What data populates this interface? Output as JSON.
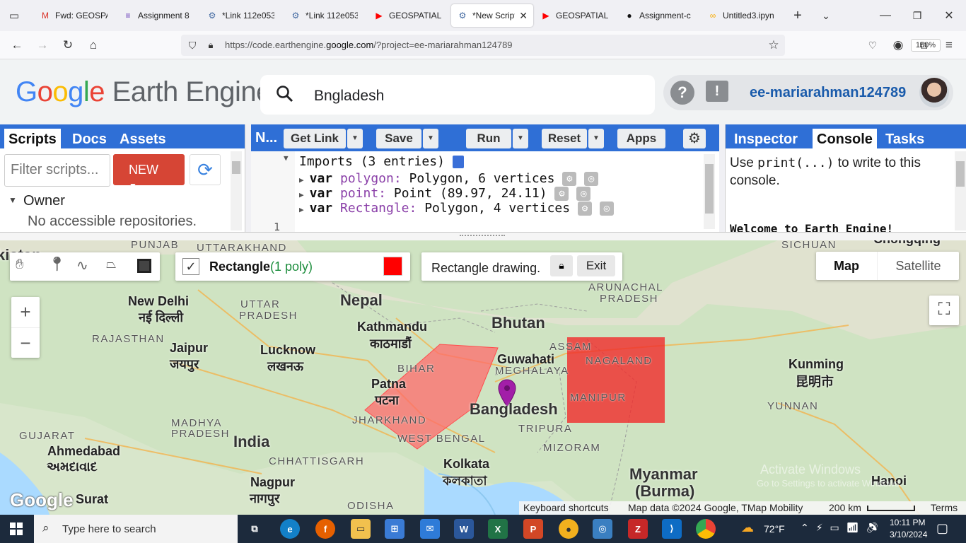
{
  "browser": {
    "tabs": [
      {
        "label": "Fwd: GEOSPAT",
        "icon": "gmail-icon",
        "color": "#d93025"
      },
      {
        "label": "Assignment 8",
        "icon": "forms-icon",
        "color": "#673ab7"
      },
      {
        "label": "*Link 112e053",
        "icon": "gear-icon",
        "color": "#4a6fa5"
      },
      {
        "label": "*Link 112e053",
        "icon": "gear-icon",
        "color": "#4a6fa5"
      },
      {
        "label": "GEOSPATIAL P",
        "icon": "youtube-icon",
        "color": "#ff0000"
      },
      {
        "label": "*New Script",
        "icon": "gear-icon",
        "color": "#4a6fa5"
      },
      {
        "label": "GEOSPATIAL P",
        "icon": "youtube-icon",
        "color": "#ff0000"
      },
      {
        "label": "Assignment-c",
        "icon": "github-icon",
        "color": "#111111"
      },
      {
        "label": "Untitled3.ipyn",
        "icon": "colab-icon",
        "color": "#f9ab00"
      }
    ],
    "url_prefix": "https://code.earthengine.",
    "url_domain": "google.com",
    "url_suffix": "/?project=ee-mariarahman124789",
    "zoom": "150%"
  },
  "header": {
    "logo_google": "Google",
    "logo_product": "Earth Engine",
    "search_value": "Bngladesh",
    "username": "ee-mariarahman124789"
  },
  "left_panel": {
    "tabs": [
      "Scripts",
      "Docs",
      "Assets"
    ],
    "filter_placeholder": "Filter scripts...",
    "new_label": "NEW",
    "owner_label": "Owner",
    "owner_empty": "No accessible repositories."
  },
  "editor": {
    "tab_label": "N...",
    "buttons": {
      "get_link": "Get Link",
      "save": "Save",
      "run": "Run",
      "reset": "Reset",
      "apps": "Apps"
    },
    "imports_header": "Imports (3 entries)",
    "imports": [
      {
        "kw": "var",
        "name": "polygon:",
        "desc": "Polygon, 6 vertices"
      },
      {
        "kw": "var",
        "name": "point:",
        "desc": "Point (89.97, 24.11)"
      },
      {
        "kw": "var",
        "name": "Rectangle:",
        "desc": "Polygon, 4 vertices"
      }
    ],
    "line_number": "1"
  },
  "right_panel": {
    "tabs": [
      "Inspector",
      "Console",
      "Tasks"
    ],
    "console_hint_1": "Use ",
    "console_hint_code": "print(...)",
    "console_hint_2": " to write to this console.",
    "welcome": "Welcome to Earth Engine!"
  },
  "map": {
    "layer_name": "Rectangle",
    "layer_count": "(1 poly)",
    "layer_color": "#ff0000",
    "drawing_status": "Rectangle drawing.",
    "exit_label": "Exit",
    "map_type": "Map",
    "satellite_type": "Satellite",
    "zoom_in": "+",
    "zoom_out": "−",
    "footer": {
      "shortcuts": "Keyboard shortcuts",
      "attribution": "Map data ©2024 Google, TMap Mobility",
      "scale": "200 km",
      "terms": "Terms"
    },
    "google_logo": "Google",
    "labels": [
      {
        "text": "PUNJAB",
        "cls": "region"
      },
      {
        "text": "UTTARAKHAND",
        "cls": "region"
      },
      {
        "text": "SICHUAN",
        "cls": "region"
      },
      {
        "text": "Chongqing",
        "cls": "city"
      },
      {
        "text": "New Delhi",
        "cls": "city"
      },
      {
        "text": "नई दिल्ली",
        "cls": "city"
      },
      {
        "text": "UTTAR",
        "cls": "region"
      },
      {
        "text": "PRADESH",
        "cls": "region"
      },
      {
        "text": "Nepal",
        "cls": "country"
      },
      {
        "text": "Kathmandu",
        "cls": "city"
      },
      {
        "text": "काठमाडौं",
        "cls": "city"
      },
      {
        "text": "Bhutan",
        "cls": "country"
      },
      {
        "text": "ARUNACHAL",
        "cls": "region"
      },
      {
        "text": "PRADESH",
        "cls": "region"
      },
      {
        "text": "RAJASTHAN",
        "cls": "region"
      },
      {
        "text": "Jaipur",
        "cls": "city"
      },
      {
        "text": "जयपुर",
        "cls": "city"
      },
      {
        "text": "Lucknow",
        "cls": "city"
      },
      {
        "text": "लखनऊ",
        "cls": "city"
      },
      {
        "text": "ASSAM",
        "cls": "region"
      },
      {
        "text": "Guwahati",
        "cls": "city"
      },
      {
        "text": "MEGHALAYA",
        "cls": "region"
      },
      {
        "text": "NAGALAND",
        "cls": "region"
      },
      {
        "text": "BIHAR",
        "cls": "region"
      },
      {
        "text": "Patna",
        "cls": "city"
      },
      {
        "text": "पटना",
        "cls": "city"
      },
      {
        "text": "Bangladesh",
        "cls": "country"
      },
      {
        "text": "MANIPUR",
        "cls": "region"
      },
      {
        "text": "Kunming",
        "cls": "city"
      },
      {
        "text": "昆明市",
        "cls": "city"
      },
      {
        "text": "YUNNAN",
        "cls": "region"
      },
      {
        "text": "MADHYA",
        "cls": "region"
      },
      {
        "text": "PRADESH",
        "cls": "region"
      },
      {
        "text": "JHARKHAND",
        "cls": "region"
      },
      {
        "text": "TRIPURA",
        "cls": "region"
      },
      {
        "text": "GUJARAT",
        "cls": "region"
      },
      {
        "text": "India",
        "cls": "country"
      },
      {
        "text": "WEST BENGAL",
        "cls": "region"
      },
      {
        "text": "MIZORAM",
        "cls": "region"
      },
      {
        "text": "Ahmedabad",
        "cls": "city"
      },
      {
        "text": "અમદાવાદ",
        "cls": "city"
      },
      {
        "text": "CHHATTISGARH",
        "cls": "region"
      },
      {
        "text": "Kolkata",
        "cls": "city"
      },
      {
        "text": "কলকাতা",
        "cls": "city"
      },
      {
        "text": "Myanmar",
        "cls": "country"
      },
      {
        "text": "(Burma)",
        "cls": "country"
      },
      {
        "text": "Hanoi",
        "cls": "city"
      },
      {
        "text": "Nagpur",
        "cls": "city"
      },
      {
        "text": "नागपुर",
        "cls": "city"
      },
      {
        "text": "Surat",
        "cls": "city"
      },
      {
        "text": "ODISHA",
        "cls": "region"
      },
      {
        "text": "kistan",
        "cls": "country"
      },
      {
        "text": "Activate Windows",
        "cls": "watermark"
      },
      {
        "text": "Go to Settings to activate Windows.",
        "cls": "watermark"
      }
    ]
  },
  "taskbar": {
    "search_placeholder": "Type here to search",
    "weather": "72°F",
    "time": "10:11 PM",
    "date": "3/10/2024"
  }
}
